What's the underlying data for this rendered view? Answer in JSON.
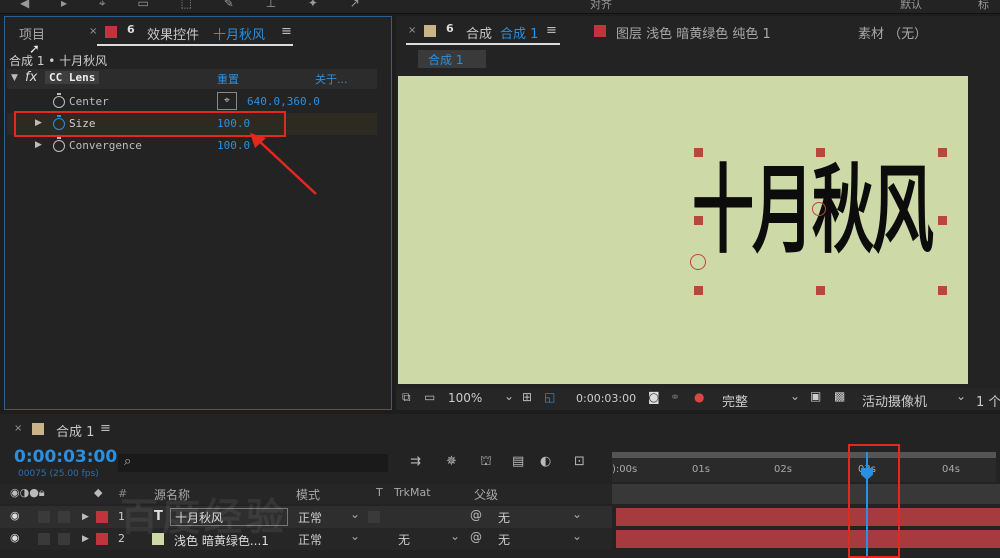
{
  "colors": {
    "accent": "#2b8fe0",
    "label_red": "#c0343d",
    "label_tan": "#c9b48a",
    "comp_bg": "#cddaa7",
    "layer_bar": "#a63a3f",
    "annotation": "#e5281f"
  },
  "topbar": {
    "left_partial": "◀ ▸ ⌖ ▭ ⬚ ✎ ⊥ ✦ ↗",
    "snap_label": "对齐",
    "right_label": "默认",
    "far_right": "标"
  },
  "project_panel": {
    "tab_project": "项目",
    "tab_effects": "效果控件",
    "effects_target": "十月秋风",
    "menu": "≡"
  },
  "effects": {
    "breadcrumb": "合成 1 • 十月秋风",
    "fx_label": "fx",
    "effect_name": "CC Lens",
    "reset": "重置",
    "about": "关于...",
    "params": [
      {
        "name": "Center",
        "value": "640.0,360.0"
      },
      {
        "name": "Size",
        "value": "100.0"
      },
      {
        "name": "Convergence",
        "value": "100.0"
      }
    ]
  },
  "comp_panel": {
    "tab_comp_prefix": "合成",
    "tab_comp_name": "合成 1",
    "tab_layer": "图层 浅色 暗黄绿色 纯色 1",
    "tab_footage": "素材 （无）",
    "subtab": "合成 1",
    "canvas_text": "十月秋风",
    "zoom": "100%",
    "timecode": "0:00:03:00",
    "quality": "完整",
    "camera": "活动摄像机",
    "views": "1 个"
  },
  "timeline": {
    "tab_name": "合成 1",
    "menu": "≡",
    "timecode": "0:00:03:00",
    "frames": "00075 (25.00 fps)",
    "search_icon": "⌕",
    "ruler": [
      "):00s",
      "01s",
      "02s",
      "03s",
      "04s"
    ],
    "col_headers": {
      "source_name": "源名称",
      "mode": "模式",
      "t": "T",
      "trkmat": "TrkMat",
      "parent": "父级",
      "hash": "#"
    },
    "layers": [
      {
        "num": "1",
        "type": "T",
        "name": "十月秋风",
        "mode": "正常",
        "trkmat": "",
        "parent": "无",
        "color": "#c0343d"
      },
      {
        "num": "2",
        "type": "",
        "name": "浅色 暗黄绿色...1",
        "mode": "正常",
        "trkmat": "无",
        "parent": "无",
        "color": "#c0343d"
      }
    ]
  },
  "watermark": "百度经验"
}
